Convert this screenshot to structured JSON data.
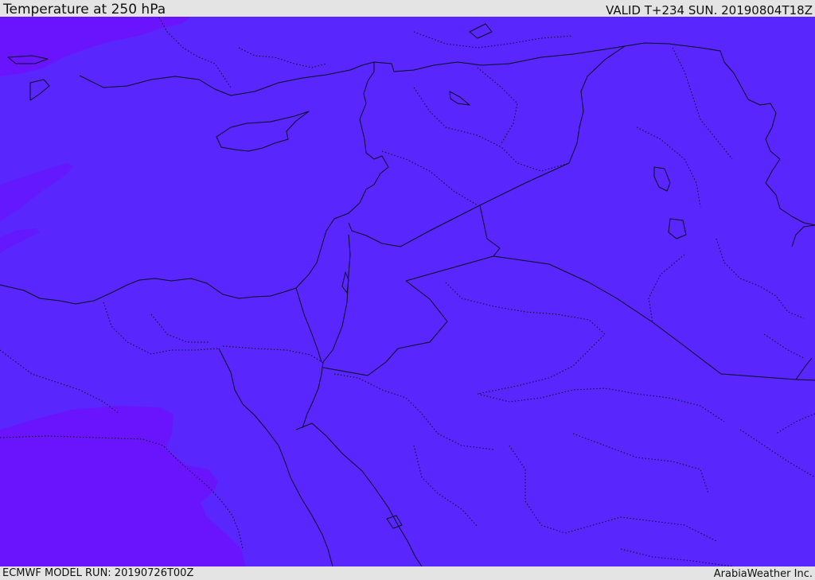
{
  "header": {
    "title": "Temperature at 250 hPa",
    "valid": "VALID T+234 SUN. 20190804T18Z"
  },
  "footer": {
    "model_run": "ECMWF MODEL RUN: 20190726T00Z",
    "credit": "ArabiaWeather Inc."
  },
  "map": {
    "field": "temperature",
    "level": "250 hPa",
    "colors": {
      "base": "#5926fd",
      "colder": "#6a14fd",
      "borders": "#0b0b1e",
      "frame": "#e4e4e4"
    }
  }
}
